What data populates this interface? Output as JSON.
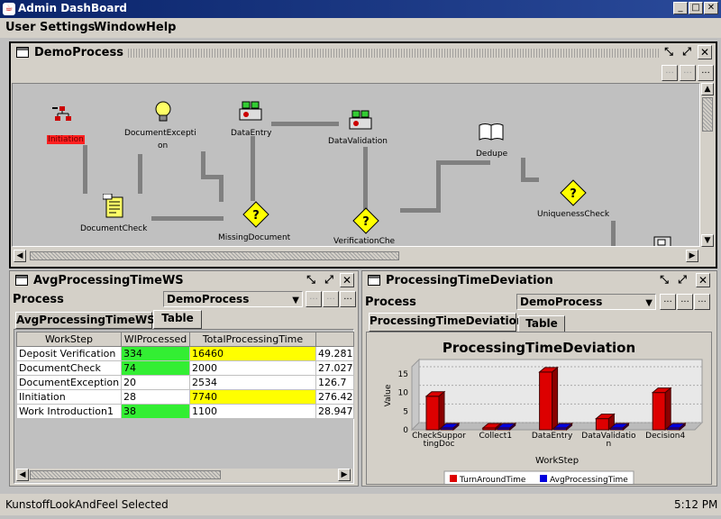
{
  "window": {
    "title": "Admin DashBoard"
  },
  "menu": [
    {
      "label": "User"
    },
    {
      "label": "Settings"
    },
    {
      "label": "Window"
    },
    {
      "label": "Help"
    }
  ],
  "demo_frame": {
    "title": "DemoProcess",
    "nodes": [
      {
        "label": "Initiation"
      },
      {
        "label": "DocumentExcepti"
      },
      {
        "label": "on"
      },
      {
        "label": "DataEntry"
      },
      {
        "label": "DataValidation"
      },
      {
        "label": "Dedupe"
      },
      {
        "label": "DocumentCheck"
      },
      {
        "label": "MissingDocument"
      },
      {
        "label": "VerificationChe"
      },
      {
        "label": "UniquenessCheck"
      }
    ]
  },
  "avg_frame": {
    "title": "AvgProcessingTimeWS",
    "process_label": "Process",
    "process_value": "DemoProcess",
    "tabs": [
      {
        "label": "AvgProcessingTimeWS"
      },
      {
        "label": "Table"
      }
    ],
    "columns": [
      "WorkStep",
      "WIProcessed",
      "TotalProcessingTime",
      ""
    ],
    "rows": [
      {
        "step": "Deposit Verification",
        "wi": "334",
        "total": "16460",
        "avg": "49.2814"
      },
      {
        "step": "DocumentCheck",
        "wi": "74",
        "total": "2000",
        "avg": "27.0270"
      },
      {
        "step": "DocumentException",
        "wi": "20",
        "total": "2534",
        "avg": "126.7"
      },
      {
        "step": "IInitiation",
        "wi": "28",
        "total": "7740",
        "avg": "276.428"
      },
      {
        "step": "Work Introduction1",
        "wi": "38",
        "total": "1100",
        "avg": "28.9473"
      }
    ],
    "highlight": {
      "green": "#33ee33",
      "yellow": "#ffff00"
    }
  },
  "dev_frame": {
    "title": "ProcessingTimeDeviation",
    "process_label": "Process",
    "process_value": "DemoProcess",
    "tabs": [
      {
        "label": "ProcessingTimeDeviation"
      },
      {
        "label": "Table"
      }
    ]
  },
  "chart_data": {
    "type": "bar",
    "title": "ProcessingTimeDeviation",
    "xlabel": "WorkStep",
    "ylabel": "Value",
    "ylim": [
      0,
      15
    ],
    "yticks": [
      "0",
      "5",
      "10",
      "15"
    ],
    "categories": [
      {
        "lines": [
          "CheckSuppor",
          "tingDoc"
        ]
      },
      {
        "lines": [
          "Collect1"
        ]
      },
      {
        "lines": [
          "DataEntry"
        ]
      },
      {
        "lines": [
          "DataValidatio",
          "n"
        ]
      },
      {
        "lines": [
          "Decision4"
        ]
      }
    ],
    "series": [
      {
        "name": "TurnAroundTime",
        "color": "#dd0000",
        "values": [
          9,
          0,
          15.5,
          3,
          10
        ]
      },
      {
        "name": "AvgProcessingTime",
        "color": "#0000dd",
        "values": [
          0,
          0,
          0,
          0,
          0
        ]
      }
    ],
    "grid": true,
    "legend": "bottom"
  },
  "status": {
    "text": "KunstoffLookAndFeel Selected",
    "time": "5:12 PM"
  }
}
